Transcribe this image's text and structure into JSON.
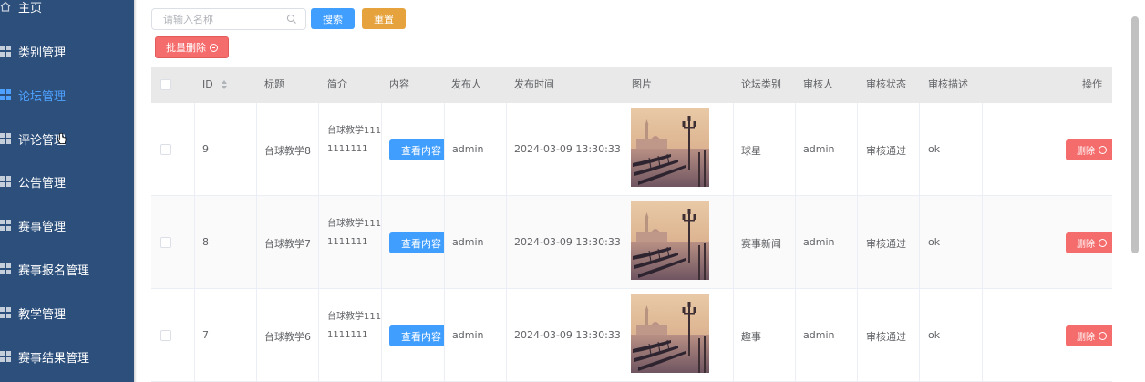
{
  "sidebar": {
    "items": [
      {
        "label": "主页",
        "icon": "home-icon",
        "active": false
      },
      {
        "label": "类别管理",
        "icon": "grid-icon",
        "active": false
      },
      {
        "label": "论坛管理",
        "icon": "grid-icon",
        "active": true
      },
      {
        "label": "评论管理",
        "icon": "grid-icon",
        "active": false
      },
      {
        "label": "公告管理",
        "icon": "grid-icon",
        "active": false
      },
      {
        "label": "赛事管理",
        "icon": "grid-icon",
        "active": false
      },
      {
        "label": "赛事报名管理",
        "icon": "grid-icon",
        "active": false
      },
      {
        "label": "教学管理",
        "icon": "grid-icon",
        "active": false
      },
      {
        "label": "赛事结果管理",
        "icon": "grid-icon",
        "active": false
      }
    ]
  },
  "toolbar": {
    "search_placeholder": "请输入名称",
    "search_value": "",
    "search_label": "搜索",
    "reset_label": "重置",
    "batch_delete_label": "批量删除"
  },
  "table": {
    "headers": {
      "id": "ID",
      "title": "标题",
      "intro": "简介",
      "content": "内容",
      "publisher": "发布人",
      "publish_time": "发布时间",
      "image": "图片",
      "category": "论坛类别",
      "reviewer": "审核人",
      "review_status": "审核状态",
      "review_desc": "审核描述",
      "actions": "操作"
    },
    "view_label": "查看内容",
    "delete_label": "删除",
    "rows": [
      {
        "id": "9",
        "title": "台球教学8",
        "intro": "台球教学1111111111",
        "publisher": "admin",
        "publish_time": "2024-03-09 13:30:33",
        "category": "球星",
        "reviewer": "admin",
        "review_status": "审核通过",
        "review_desc": "ok"
      },
      {
        "id": "8",
        "title": "台球教学7",
        "intro": "台球教学1111111111",
        "publisher": "admin",
        "publish_time": "2024-03-09 13:30:33",
        "category": "赛事新闻",
        "reviewer": "admin",
        "review_status": "审核通过",
        "review_desc": "ok"
      },
      {
        "id": "7",
        "title": "台球教学6",
        "intro": "台球教学1111111111",
        "publisher": "admin",
        "publish_time": "2024-03-09 13:30:33",
        "category": "趣事",
        "reviewer": "admin",
        "review_status": "审核通过",
        "review_desc": "ok"
      }
    ]
  },
  "colors": {
    "sidebar_bg": "#2c4f7c",
    "active": "#4fa1ff",
    "primary": "#409eff",
    "warning": "#e6a23c",
    "danger": "#f56c6c"
  }
}
